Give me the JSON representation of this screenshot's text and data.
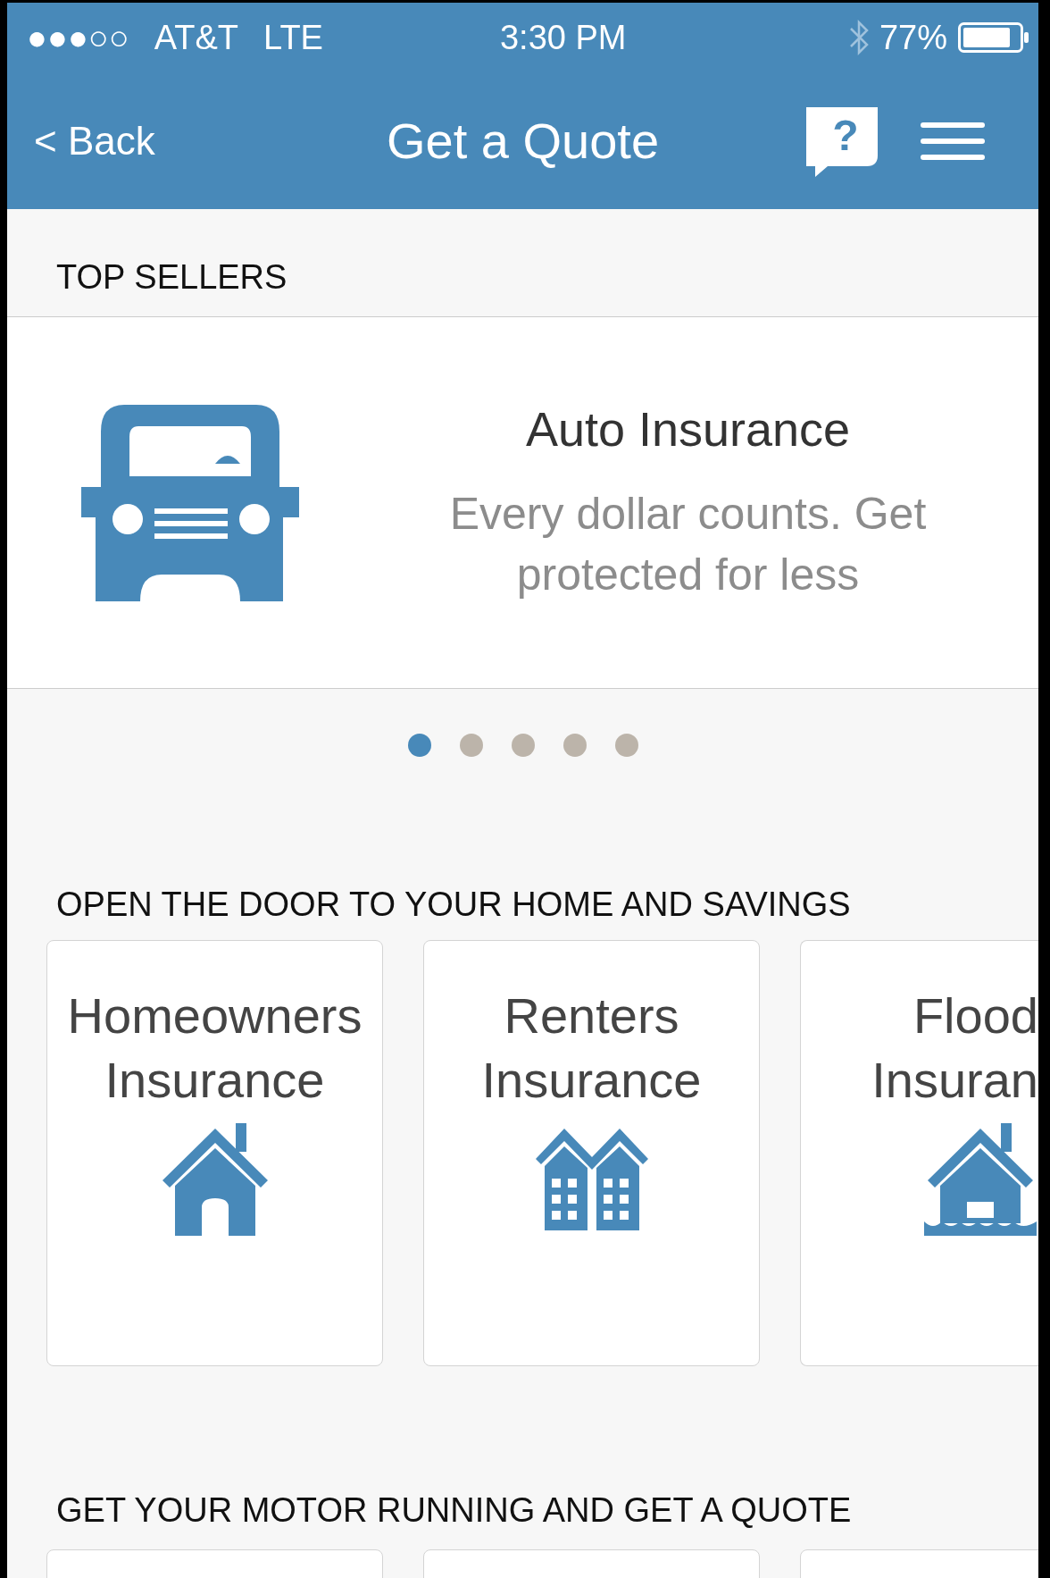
{
  "status_bar": {
    "signal": "●●●○○",
    "carrier": "AT&T",
    "network": "LTE",
    "time": "3:30 PM",
    "battery": "77%"
  },
  "nav": {
    "back": "< Back",
    "title": "Get a Quote",
    "help_glyph": "?"
  },
  "top_sellers": {
    "heading": "TOP SELLERS",
    "slide": {
      "title": "Auto Insurance",
      "subtitle": "Every dollar counts. Get protected for less",
      "kind": "car"
    },
    "dots": [
      {
        "selected": true
      },
      {
        "selected": false
      },
      {
        "selected": false
      },
      {
        "selected": false
      },
      {
        "selected": false
      }
    ]
  },
  "home_section": {
    "heading": "OPEN THE DOOR TO YOUR HOME AND SAVINGS",
    "tiles": [
      {
        "title": "Homeowners Insurance",
        "kind": "house"
      },
      {
        "title": "Renters Insurance",
        "kind": "buildings"
      },
      {
        "title": "Flood Insuran",
        "kind": "flood"
      }
    ]
  },
  "motor_section": {
    "heading": "GET YOUR MOTOR RUNNING AND GET A QUOTE",
    "tiles": [
      {
        "kind": "card"
      },
      {
        "kind": "card"
      },
      {
        "kind": "card"
      }
    ]
  }
}
